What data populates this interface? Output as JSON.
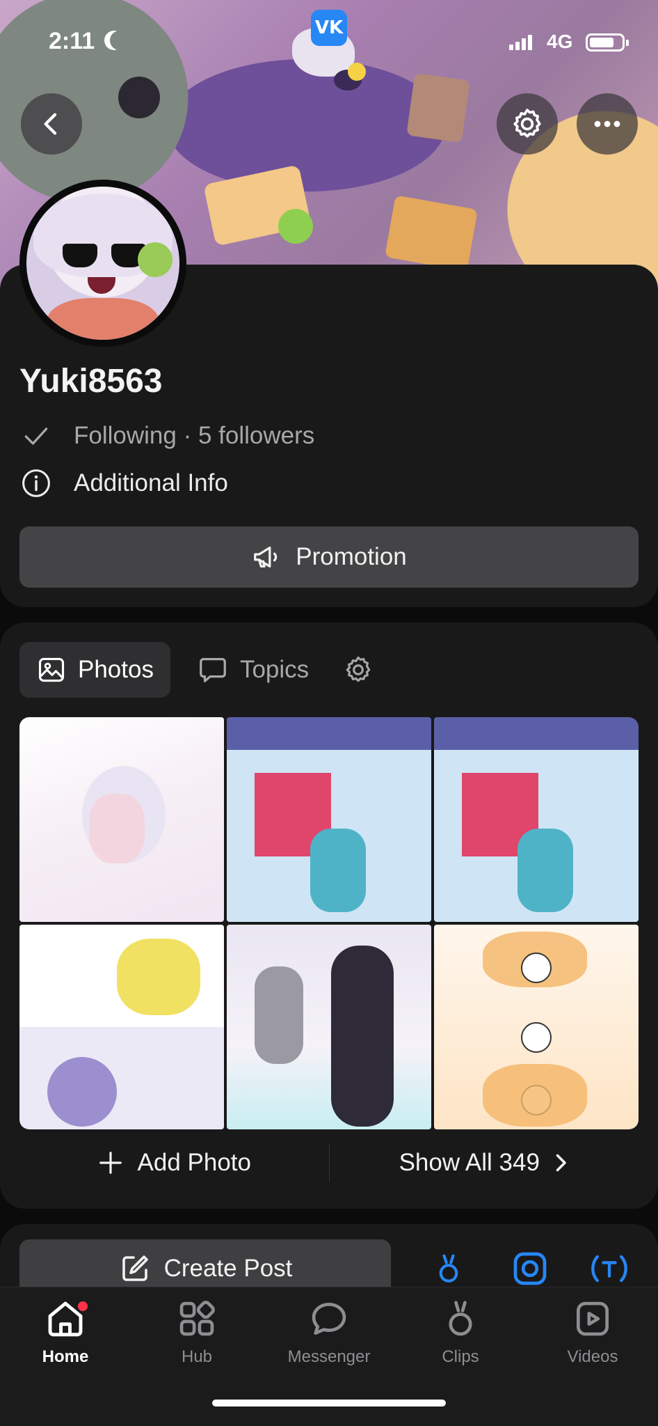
{
  "status_bar": {
    "time": "2:11",
    "network": "4G",
    "app_badge": "VK"
  },
  "profile": {
    "name": "Yuki8563",
    "following_text": "Following · 5 followers",
    "additional_info": "Additional Info",
    "promotion_label": "Promotion"
  },
  "photos": {
    "tabs": [
      {
        "label": "Photos",
        "active": true
      },
      {
        "label": "Topics",
        "active": false
      }
    ],
    "add_photo_label": "Add Photo",
    "show_all_label": "Show All 349",
    "thumbnails": [
      "comic-page-1",
      "comic-page-2",
      "comic-page-3",
      "comic-page-4",
      "character-art",
      "sketch-page"
    ]
  },
  "create_post": {
    "label": "Create Post"
  },
  "tabbar": {
    "items": [
      {
        "label": "Home",
        "active": true,
        "has_badge": true
      },
      {
        "label": "Hub",
        "active": false
      },
      {
        "label": "Messenger",
        "active": false
      },
      {
        "label": "Clips",
        "active": false
      },
      {
        "label": "Videos",
        "active": false
      }
    ]
  },
  "colors": {
    "background": "#0b0b0c",
    "card": "#19191a",
    "button": "#444446",
    "accent_blue": "#2787f5",
    "badge_red": "#ff3347"
  }
}
